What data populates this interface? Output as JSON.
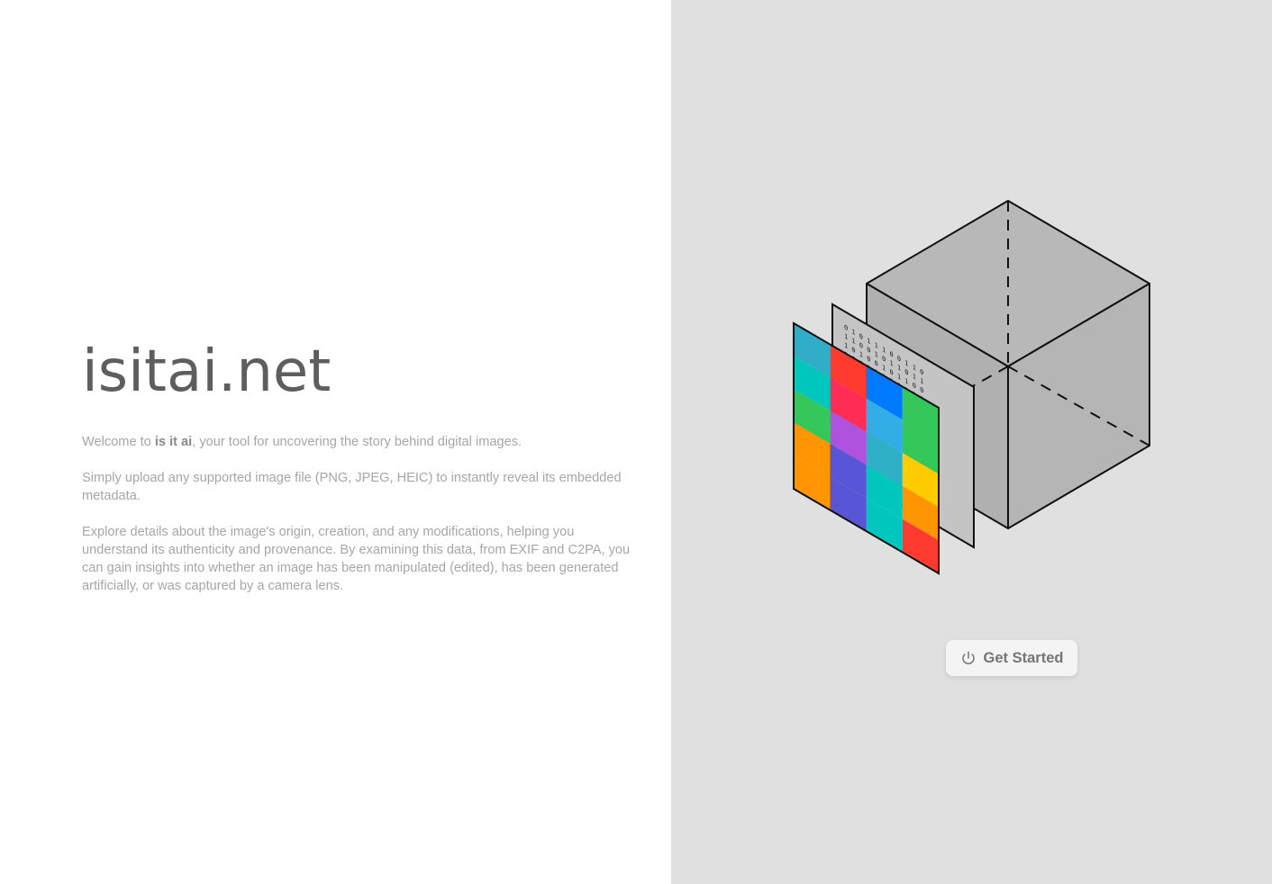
{
  "left": {
    "title": "isitai.net",
    "intro": {
      "p1_before": "Welcome to ",
      "p1_bold": "is it ai",
      "p1_after": ", your tool for uncovering the story behind digital images.",
      "p2": "Simply upload any supported image file (PNG, JPEG, HEIC) to instantly reveal its embedded metadata.",
      "p3": "Explore details about the image's origin, creation, and any modifications, helping you understand its authenticity and provenance. By examining this data, from EXIF and C2PA, you can gain insights into whether an image has been manipulated (edited), has been generated artificially, or was captured by a camera lens."
    }
  },
  "right": {
    "illustration_icon": "isometric-cube-with-image-layers",
    "binary_text": [
      "0 1 0 1 1 1 0 0 1 1 0",
      "1 1 0 0 1 0 1 1 0 1 1",
      "1 0 1 0 0 1 0 1 1 0 0",
      "1 0 0 1 1 0 1 0 1 1 1"
    ],
    "button": {
      "label": "Get Started",
      "icon": "power-icon"
    }
  },
  "colors": {
    "background_right": "#e0e0e0",
    "cube_fill": "#b4b4b4",
    "grid": [
      "#30aec8",
      "#ff3b30",
      "#007aff",
      "#34c759",
      "#00c7be",
      "#ff2d55",
      "#32ade6",
      "#34c759",
      "#34c759",
      "#af52de",
      "#30b0c7",
      "#ffcc00",
      "#ff9500",
      "#5856d6",
      "#00c7be",
      "#ff9500",
      "#ff9500",
      "#5856d6",
      "#00c7be",
      "#ff3b30"
    ]
  }
}
